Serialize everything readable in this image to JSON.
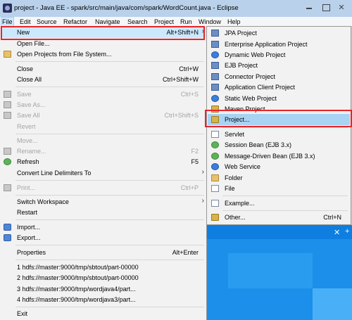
{
  "window": {
    "title": "project - Java EE - spark/src/main/java/com/spark/WordCount.java - Eclipse"
  },
  "menubar": [
    "File",
    "Edit",
    "Source",
    "Refactor",
    "Navigate",
    "Search",
    "Project",
    "Run",
    "Window",
    "Help"
  ],
  "file_menu": {
    "new": {
      "label": "New",
      "accel": "Alt+Shift+N"
    },
    "open_file": {
      "label": "Open File..."
    },
    "open_projects": {
      "label": "Open Projects from File System..."
    },
    "close": {
      "label": "Close",
      "accel": "Ctrl+W"
    },
    "close_all": {
      "label": "Close All",
      "accel": "Ctrl+Shift+W"
    },
    "save": {
      "label": "Save",
      "accel": "Ctrl+S"
    },
    "save_as": {
      "label": "Save As..."
    },
    "save_all": {
      "label": "Save All",
      "accel": "Ctrl+Shift+S"
    },
    "revert": {
      "label": "Revert"
    },
    "move": {
      "label": "Move..."
    },
    "rename": {
      "label": "Rename...",
      "accel": "F2"
    },
    "refresh": {
      "label": "Refresh",
      "accel": "F5"
    },
    "convert": {
      "label": "Convert Line Delimiters To"
    },
    "print": {
      "label": "Print...",
      "accel": "Ctrl+P"
    },
    "switch_ws": {
      "label": "Switch Workspace"
    },
    "restart": {
      "label": "Restart"
    },
    "import": {
      "label": "Import..."
    },
    "export": {
      "label": "Export..."
    },
    "properties": {
      "label": "Properties",
      "accel": "Alt+Enter"
    },
    "recent": [
      "1 hdfs://master:9000/tmp/sbtout/part-00000",
      "2 hdfs://master:9000/tmp/sbtout/part-00000",
      "3 hdfs://master:9000/tmp/wordjava4/part...",
      "4 hdfs://master:9000/tmp/wordjava3/part..."
    ],
    "exit": {
      "label": "Exit"
    }
  },
  "new_submenu": {
    "items": [
      "JPA Project",
      "Enterprise Application Project",
      "Dynamic Web Project",
      "EJB Project",
      "Connector Project",
      "Application Client Project",
      "Static Web Project",
      "Maven Project",
      "Project...",
      "Servlet",
      "Session Bean (EJB 3.x)",
      "Message-Driven Bean (EJB 3.x)",
      "Web Service",
      "Folder",
      "File",
      "Example...",
      "Other..."
    ],
    "other_accel": "Ctrl+N"
  },
  "colors": {
    "highlight_border": "#e8252a",
    "selected_row": "#cce8ff",
    "titlebar": "#b9d1ea"
  }
}
